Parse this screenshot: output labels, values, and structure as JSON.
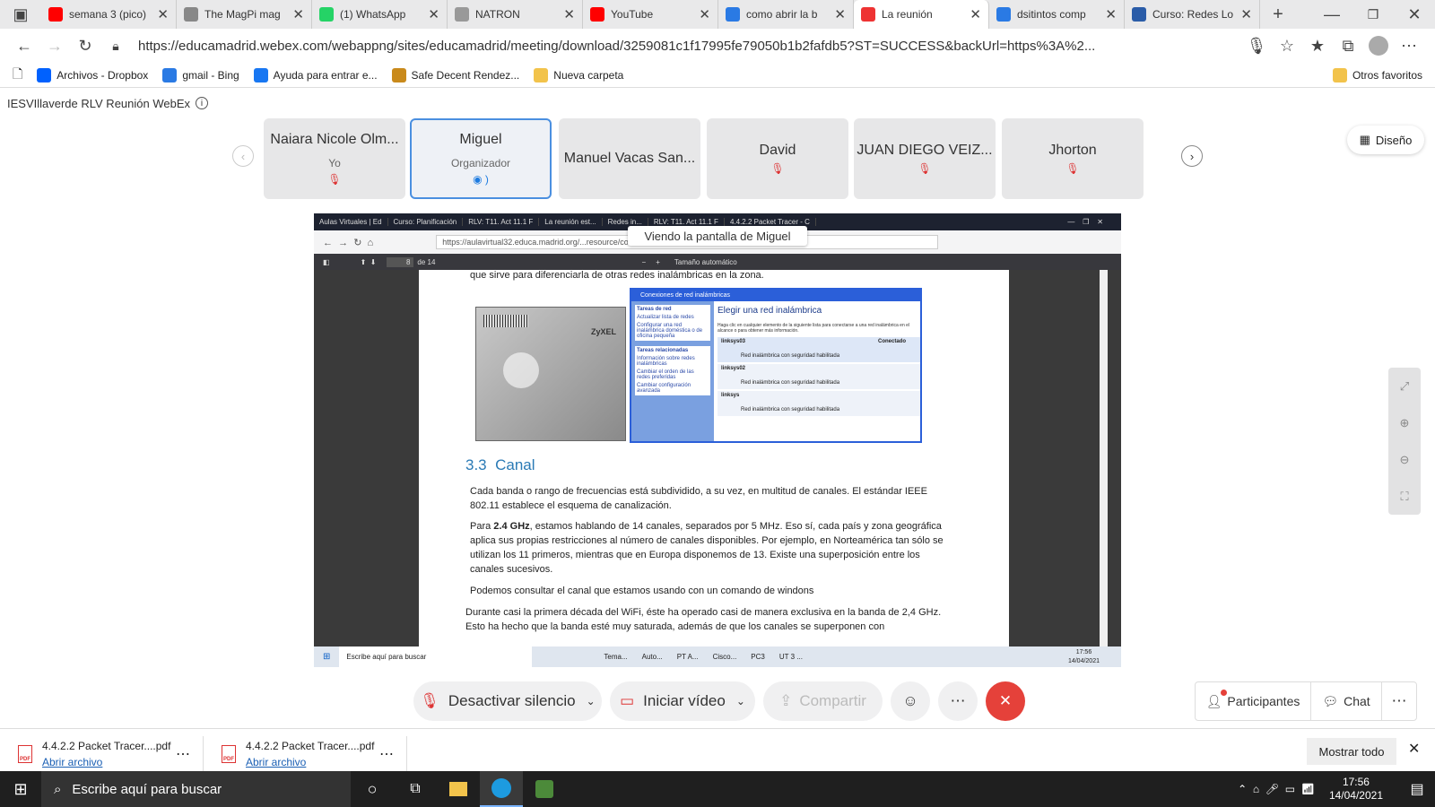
{
  "tabs": [
    {
      "title": "semana 3 (pico)",
      "color": "#ff0000"
    },
    {
      "title": "The MagPi mag",
      "color": "#888888"
    },
    {
      "title": "(1) WhatsApp",
      "color": "#25d366"
    },
    {
      "title": "NATRON",
      "color": "#999999"
    },
    {
      "title": "YouTube",
      "color": "#ff0000"
    },
    {
      "title": "como abrir la b",
      "color": "#2a7ae4"
    },
    {
      "title": "La reunión",
      "color": "#e33"
    },
    {
      "title": "dsitintos comp",
      "color": "#2a7ae4"
    },
    {
      "title": "Curso: Redes Lo",
      "color": "#2a5ca8"
    }
  ],
  "address": {
    "url": "https://educamadrid.webex.com/webappng/sites/educamadrid/meeting/download/3259081c1f17995fe79050b1b2fafdb5?ST=SUCCESS&backUrl=https%3A%2..."
  },
  "favorites": [
    {
      "label": "Archivos - Dropbox",
      "color": "#0061fe"
    },
    {
      "label": "gmail - Bing",
      "color": "#2a7ae4"
    },
    {
      "label": "Ayuda para entrar e...",
      "color": "#1877f2"
    },
    {
      "label": "Safe Decent Rendez...",
      "color": "#c98a1b"
    },
    {
      "label": "Nueva carpeta",
      "color": "#f2c34b"
    }
  ],
  "other_favorites": "Otros favoritos",
  "meeting": {
    "title": "IESVIllaverde RLV Reunión WebEx",
    "layout_button": "Diseño",
    "viewing_label": "Viendo la pantalla de Miguel"
  },
  "participants": [
    {
      "name": "Naiara Nicole Olm...",
      "role": "Yo",
      "muted": true
    },
    {
      "name": "Miguel",
      "role": "Organizador",
      "muted": false
    },
    {
      "name": "Manuel Vacas San...",
      "role": "",
      "muted": false
    },
    {
      "name": "David",
      "role": "",
      "muted": true
    },
    {
      "name": "JUAN DIEGO VEIZ...",
      "role": "",
      "muted": true
    },
    {
      "name": "Jhorton",
      "role": "",
      "muted": true
    }
  ],
  "shared": {
    "inner_tabs": [
      "Aulas Virtuales | Ed",
      "Curso: Planificación",
      "RLV: T11. Act 11.1 F",
      "La reunión est...",
      "Redes in...",
      "RLV: T11. Act 11.1 F",
      "4.4.2.2 Packet Tracer - C"
    ],
    "inner_url": "https://aulavirtual32.educa.madrid.org/...resource/content/3/Tema 11",
    "page_current": "8",
    "page_total": "de 14",
    "zoom": "Tamaño automático",
    "top_line": "que sirve para diferenciarla de otras redes inalámbricas en la zona.",
    "win_title": "Conexiones de red inalámbricas",
    "win_heading": "Elegir una red inalámbrica",
    "win_desc": "Haga clic en cualquier elemento de la siguiente lista para conectarse a una red inalámbrica en el alcance o para obtener más información.",
    "win_side_title1": "Tareas de red",
    "win_side_items1": [
      "Actualizar lista de redes",
      "Configurar una red inalámbrica doméstica o de oficina pequeña"
    ],
    "win_side_title2": "Tareas relacionadas",
    "win_side_items2": [
      "Información sobre redes inalámbricas",
      "Cambiar el orden de las redes preferidas",
      "Cambiar configuración avanzada"
    ],
    "networks": [
      {
        "name": "linksys03",
        "status": "Conectado",
        "sec": "Red inalámbrica con seguridad habilitada"
      },
      {
        "name": "linksys02",
        "status": "",
        "sec": "Red inalámbrica con seguridad habilitada"
      },
      {
        "name": "linksys",
        "status": "",
        "sec": "Red inalámbrica con seguridad habilitada"
      }
    ],
    "router_brand": "ZyXEL",
    "section_num": "3.3",
    "section_title": "Canal",
    "p1": "Cada banda o rango de frecuencias está subdividido, a su vez, en multitud de canales. El estándar IEEE 802.11 establece el esquema de canalización.",
    "p2_pre": "Para ",
    "p2_bold": "2.4 GHz",
    "p2_post": ", estamos hablando de 14 canales, separados por 5 MHz. Eso sí, cada país y zona geográfica aplica sus propias restricciones al número de canales disponibles. Por ejemplo, en Norteamérica tan sólo se utilizan los 11 primeros, mientras que en Europa disponemos de 13. Existe una superposición entre los canales sucesivos.",
    "p3": "Podemos consultar el canal que estamos usando con un comando de windons",
    "p4": "Durante casi la primera década del WiFi, éste ha operado casi de manera exclusiva en la banda de 2,4 GHz. Esto ha hecho que la banda esté muy saturada, además de que los canales se superponen con",
    "inner_taskbar": {
      "search": "Escribe aquí para buscar",
      "apps": [
        "Tema...",
        "Auto...",
        "PT A...",
        "Cisco...",
        "PC3",
        "UT 3 ..."
      ],
      "time": "17:56",
      "date": "14/04/2021"
    }
  },
  "controls": {
    "mute": "Desactivar silencio",
    "video": "Iniciar vídeo",
    "share": "Compartir",
    "participants": "Participantes",
    "chat": "Chat"
  },
  "downloads": [
    {
      "name": "4.4.2.2 Packet Tracer....pdf",
      "action": "Abrir archivo"
    },
    {
      "name": "4.4.2.2 Packet Tracer....pdf",
      "action": "Abrir archivo"
    }
  ],
  "show_all": "Mostrar todo",
  "taskbar": {
    "search": "Escribe aquí para buscar",
    "time": "17:56",
    "date": "14/04/2021"
  }
}
